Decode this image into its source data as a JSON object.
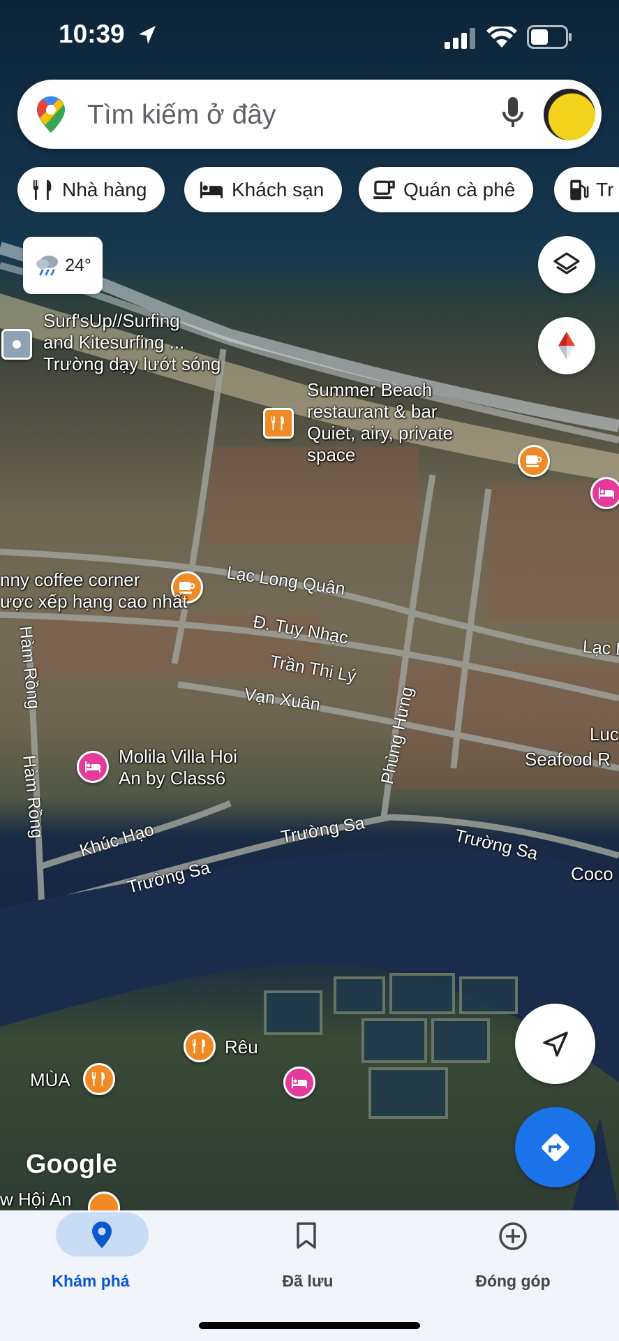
{
  "status_bar": {
    "time": "10:39"
  },
  "search": {
    "placeholder": "Tìm kiếm ở đây"
  },
  "chips": [
    {
      "label": "Nhà hàng",
      "icon": "utensils-icon"
    },
    {
      "label": "Khách sạn",
      "icon": "bed-icon"
    },
    {
      "label": "Quán cà phê",
      "icon": "coffee-icon"
    },
    {
      "label": "Tr",
      "icon": "gas-station-icon"
    }
  ],
  "weather": {
    "temperature": "24°",
    "icon": "rain-cloud-icon"
  },
  "map": {
    "places": [
      {
        "name_line1": "Surf'sUp//Surfing",
        "name_line2": "and Kitesurfing ...",
        "subtitle": "Trường dạy lướt sóng"
      },
      {
        "name_line1": "Summer Beach",
        "name_line2": "restaurant & bar",
        "subtitle_line1": "Quiet, airy, private",
        "subtitle_line2": "space"
      },
      {
        "name": "nny coffee corner",
        "subtitle": "ược xếp hạng cao nhất"
      },
      {
        "name_line1": "Molila Villa Hoi",
        "name_line2": "An by Class6"
      },
      {
        "name": "Rêu"
      },
      {
        "name": "MÙA"
      },
      {
        "name": "Seafood R"
      },
      {
        "name": "Luc"
      },
      {
        "name": "Coco"
      },
      {
        "name": "w Hội An"
      }
    ],
    "roads": [
      "Lạc Long Quân",
      "Đ. Tuy Nhạc",
      "Trần Thị Lý",
      "Vạn Xuân",
      "Phùng Hưng",
      "Hàm Rồng",
      "Hàm Rồng",
      "Khúc Hạo",
      "Trường Sa",
      "Trường Sa",
      "Trường Sa",
      "Lạc L"
    ],
    "watermark": "Google"
  },
  "bottom_nav": {
    "items": [
      {
        "label": "Khám phá",
        "icon": "explore-pin-icon",
        "active": true
      },
      {
        "label": "Đã lưu",
        "icon": "bookmark-icon",
        "active": false
      },
      {
        "label": "Đóng góp",
        "icon": "add-circle-icon",
        "active": false
      }
    ]
  },
  "colors": {
    "accent_blue": "#1a73e8",
    "restaurant_pin": "#f08a24",
    "hotel_pin": "#e5399c",
    "nav_active": "#0b57d0"
  }
}
